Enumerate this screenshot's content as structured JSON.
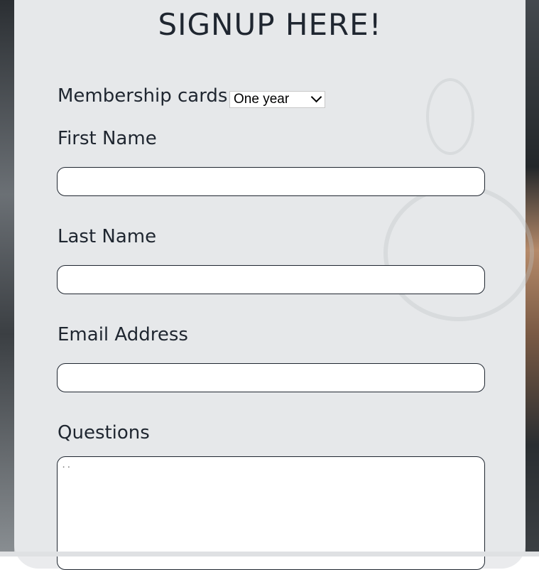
{
  "form": {
    "title": "SIGNUP HERE!",
    "membership_label": "Membership cards",
    "membership_selected": "One year",
    "first_name_label": "First Name",
    "last_name_label": "Last Name",
    "email_label": "Email Address",
    "questions_label": "Questions",
    "questions_value": "..",
    "first_name_value": "",
    "last_name_value": "",
    "email_value": ""
  },
  "icons": {
    "select_chevron": "chevron-down-icon"
  },
  "colors": {
    "text": "#1f2630",
    "card_bg": "#e8eaec",
    "input_border": "#1f2630",
    "input_bg": "#ffffff"
  }
}
